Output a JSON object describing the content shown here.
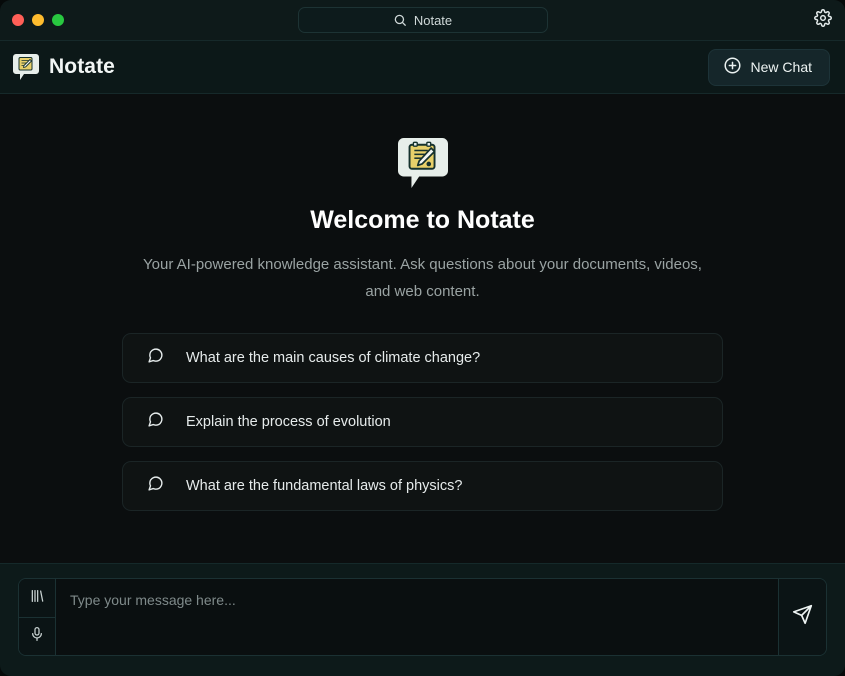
{
  "window": {
    "traffic_lights": [
      {
        "name": "close",
        "color": "#ff5f57"
      },
      {
        "name": "minimize",
        "color": "#febc2e"
      },
      {
        "name": "maximize",
        "color": "#28c840"
      }
    ],
    "search_value": "Notate",
    "search_icon": "search-icon",
    "settings_icon": "gear-icon"
  },
  "header": {
    "logo_icon": "notate-logo-icon",
    "title": "Notate",
    "new_chat": {
      "label": "New Chat",
      "icon": "plus-circle-icon"
    }
  },
  "main": {
    "hero_icon": "notate-logo-icon",
    "title": "Welcome to Notate",
    "subtitle": "Your AI-powered knowledge assistant. Ask questions about your documents, videos, and web content.",
    "suggestions": [
      {
        "icon": "message-square-icon",
        "text": "What are the main causes of climate change?"
      },
      {
        "icon": "message-square-icon",
        "text": "Explain the process of evolution"
      },
      {
        "icon": "message-square-icon",
        "text": "What are the fundamental laws of physics?"
      }
    ]
  },
  "composer": {
    "library_icon": "library-icon",
    "microphone_icon": "microphone-icon",
    "input_value": "",
    "input_placeholder": "Type your message here...",
    "send_icon": "send-icon"
  },
  "colors": {
    "titlebar_bg": "#0e1a1a",
    "header_bg": "#0c1818",
    "main_bg": "#0b0e0f",
    "composer_bg": "#0d1a1a",
    "card_bg": "#0f1313",
    "border": "#1b3133",
    "text_primary": "#ffffff",
    "text_muted": "#9aa3a3",
    "logo_paper": "#e8d06a",
    "logo_surface": "#e8eeea"
  }
}
